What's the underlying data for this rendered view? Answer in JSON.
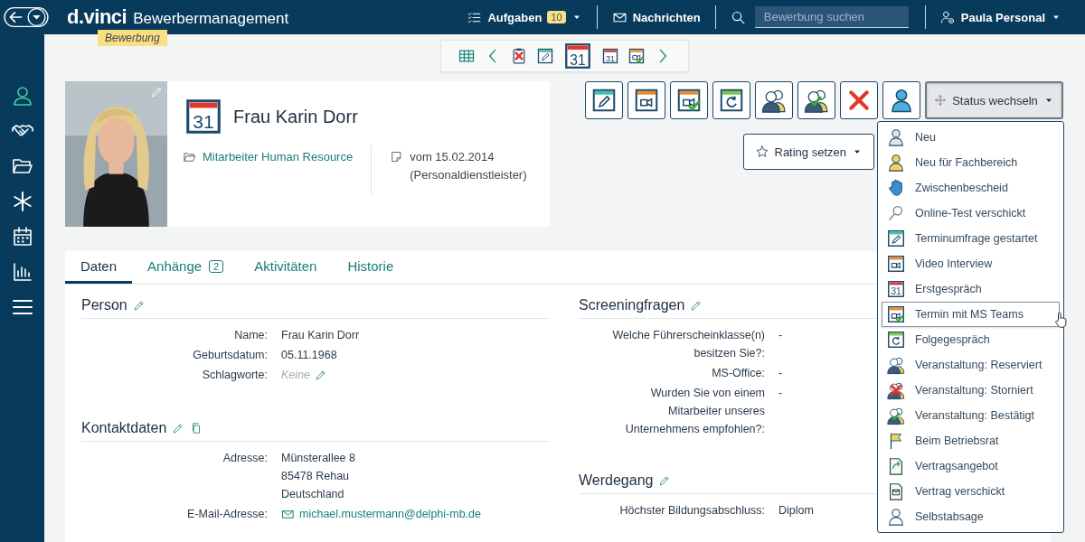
{
  "header": {
    "logo": "d.vinci",
    "product": "Bewerbermanagement",
    "context_badge": "Bewerbung",
    "tasks": {
      "label": "Aufgaben",
      "count": "10"
    },
    "messages": "Nachrichten",
    "search": {
      "placeholder": "Bewerbung suchen"
    },
    "user": "Paula Personal"
  },
  "sidebar": {
    "items": [
      {
        "selected": true
      },
      {
        "selected": false
      },
      {
        "selected": false
      },
      {
        "selected": false
      },
      {
        "selected": false
      },
      {
        "selected": false
      },
      {
        "selected": false
      }
    ]
  },
  "nav_toolbar": {
    "items": [
      {
        "selected": false
      },
      {
        "selected": false
      },
      {
        "selected": false
      },
      {
        "selected": false
      },
      {
        "label": "31",
        "selected": true
      },
      {
        "label": "31",
        "selected": false
      },
      {
        "selected": false
      },
      {
        "selected": false
      }
    ]
  },
  "profile": {
    "calendar_label": "31",
    "name": "Frau Karin Dorr",
    "job": "Mitarbeiter Human Resource",
    "date": "vom 15.02.2014",
    "source": "(Personaldienstleister)"
  },
  "status_button": {
    "label": "Status wechseln",
    "expanded": true
  },
  "rating_button": {
    "label": "Rating setzen"
  },
  "status_menu": [
    {
      "label": "Neu",
      "highlighted": false
    },
    {
      "label": "Neu für Fachbereich",
      "highlighted": false
    },
    {
      "label": "Zwischenbescheid",
      "highlighted": false
    },
    {
      "label": "Online-Test verschickt",
      "highlighted": false
    },
    {
      "label": "Terminumfrage gestartet",
      "highlighted": false
    },
    {
      "label": "Video Interview",
      "highlighted": false
    },
    {
      "label": "Erstgespräch",
      "icon_label": "31",
      "highlighted": false
    },
    {
      "label": "Termin mit MS Teams",
      "highlighted": true
    },
    {
      "label": "Folgegespräch",
      "highlighted": false
    },
    {
      "label": "Veranstaltung: Reserviert",
      "highlighted": false
    },
    {
      "label": "Veranstaltung: Storniert",
      "highlighted": false
    },
    {
      "label": "Veranstaltung: Bestätigt",
      "highlighted": false
    },
    {
      "label": "Beim Betriebsrat",
      "highlighted": false
    },
    {
      "label": "Vertragsangebot",
      "highlighted": false
    },
    {
      "label": "Vertrag verschickt",
      "highlighted": false
    },
    {
      "label": "Selbstabsage",
      "highlighted": false
    }
  ],
  "tabs": [
    {
      "label": "Daten",
      "selected": true
    },
    {
      "label": "Anhänge",
      "count": "2",
      "selected": false
    },
    {
      "label": "Aktivitäten",
      "selected": false
    },
    {
      "label": "Historie",
      "selected": false
    }
  ],
  "left_sections": [
    {
      "title": "Person",
      "kind": "plain",
      "rows": [
        {
          "label": "Name:",
          "kind": "text",
          "value": [
            "Frau Karin Dorr"
          ]
        },
        {
          "label": "Geburtsdatum:",
          "kind": "text",
          "value": [
            "05.11.1968"
          ]
        },
        {
          "label": "Schlagworte:",
          "kind": "empty",
          "value": [
            "Keine"
          ]
        }
      ]
    },
    {
      "title": "Kontaktdaten",
      "kind": "contact",
      "rows": [
        {
          "label": "Adresse:",
          "kind": "text",
          "value": [
            "Münsterallee 8",
            "85478 Rehau",
            "Deutschland"
          ]
        },
        {
          "label": "E-Mail-Adresse:",
          "kind": "email",
          "value": [
            "michael.mustermann@delphi-mb.de"
          ]
        }
      ]
    }
  ],
  "right_sections": [
    {
      "title": "Screeningfragen",
      "kind": "plain",
      "rows": [
        {
          "label": "Welche Führerscheinklasse(n) besitzen Sie?:",
          "kind": "text",
          "value": [
            "-"
          ]
        },
        {
          "label": "MS-Office:",
          "kind": "text",
          "value": [
            "-"
          ]
        },
        {
          "label": "Wurden Sie von einem Mitarbeiter unseres Unternehmens empfohlen?:",
          "kind": "text",
          "value": [
            "-"
          ]
        }
      ]
    },
    {
      "title": "Werdegang",
      "kind": "plain",
      "rows": [
        {
          "label": "Höchster Bildungsabschluss:",
          "kind": "text",
          "value": [
            "Diplom"
          ]
        }
      ]
    }
  ]
}
